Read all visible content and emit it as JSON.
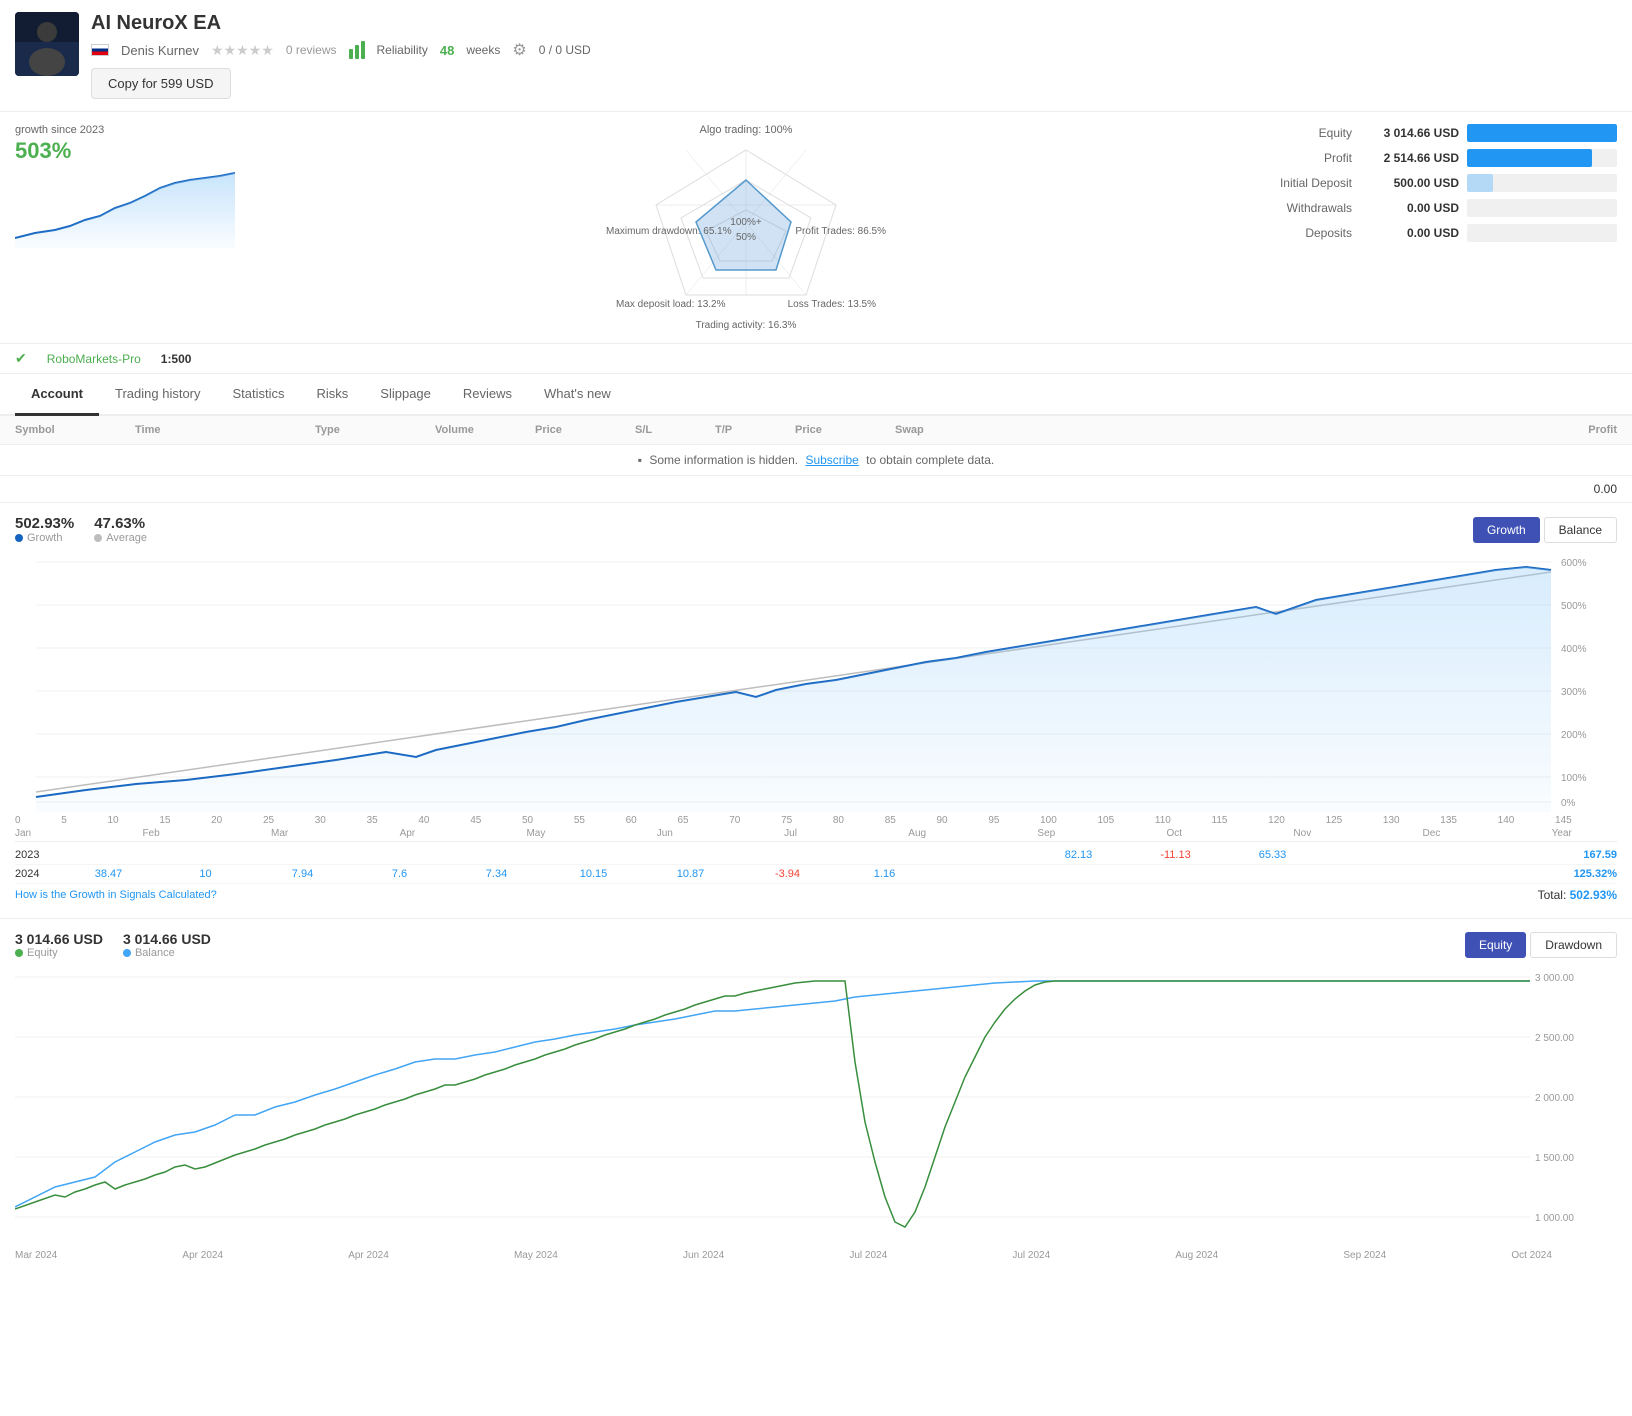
{
  "header": {
    "title": "AI NeuroX EA",
    "author": "Denis Kurnev",
    "reviews": "0 reviews",
    "reliability_label": "Reliability",
    "weeks": "48",
    "weeks_label": "weeks",
    "balance": "0 / 0 USD",
    "copy_btn": "Copy for 599 USD"
  },
  "stats": {
    "growth_since": "growth since 2023",
    "growth_value": "503%",
    "algo_trading": "Algo trading: 100%",
    "max_drawdown": "Maximum drawdown: 65.1%",
    "profit_trades": "Profit Trades: 86.5%",
    "loss_trades": "Loss Trades: 13.5%",
    "max_deposit_load": "Max deposit load: 13.2%",
    "trading_activity": "Trading activity: 16.3%"
  },
  "equity": {
    "rows": [
      {
        "label": "Equity",
        "value": "3 014.66 USD",
        "pct": 100,
        "color": "blue"
      },
      {
        "label": "Profit",
        "value": "2 514.66 USD",
        "pct": 83,
        "color": "blue"
      },
      {
        "label": "Initial Deposit",
        "value": "500.00 USD",
        "pct": 17,
        "color": "light-blue"
      },
      {
        "label": "Withdrawals",
        "value": "0.00 USD",
        "pct": 0,
        "color": "blue"
      },
      {
        "label": "Deposits",
        "value": "0.00 USD",
        "pct": 0,
        "color": "blue"
      }
    ]
  },
  "broker": {
    "name": "RoboMarkets-Pro",
    "leverage": "1:500"
  },
  "tabs": [
    {
      "label": "Account",
      "active": true
    },
    {
      "label": "Trading history",
      "active": false
    },
    {
      "label": "Statistics",
      "active": false
    },
    {
      "label": "Risks",
      "active": false
    },
    {
      "label": "Slippage",
      "active": false
    },
    {
      "label": "Reviews",
      "active": false
    },
    {
      "label": "What's new",
      "active": false
    }
  ],
  "table": {
    "columns": [
      "Symbol",
      "Time",
      "Type",
      "Volume",
      "Price",
      "S/L",
      "T/P",
      "Price",
      "Swap",
      "Profit"
    ],
    "hidden_msg": "Some information is hidden.",
    "subscribe_text": "Subscribe",
    "hidden_msg2": "to obtain complete data.",
    "profit_value": "0.00"
  },
  "growth_chart": {
    "stat1_value": "502.93%",
    "stat1_label": "Growth",
    "stat2_value": "47.63%",
    "stat2_label": "Average",
    "btn_growth": "Growth",
    "btn_balance": "Balance",
    "y_labels": [
      "600%",
      "500%",
      "400%",
      "300%",
      "200%",
      "100%",
      "0%"
    ],
    "x_labels": [
      "0",
      "5",
      "10",
      "15",
      "20",
      "25",
      "30",
      "35",
      "40",
      "45",
      "50",
      "55",
      "60",
      "65",
      "70",
      "75",
      "80",
      "85",
      "90",
      "95",
      "100",
      "105",
      "110",
      "115",
      "120",
      "125",
      "130",
      "135",
      "140",
      "145"
    ],
    "month_labels": [
      "Jan",
      "Feb",
      "Mar",
      "Apr",
      "May",
      "Jun",
      "Jul",
      "Aug",
      "Sep",
      "Oct",
      "Nov",
      "Dec",
      "Year"
    ],
    "year_rows": [
      {
        "year": "2023",
        "values": [
          "",
          "",
          "",
          "",
          "",
          "",
          "",
          "",
          "",
          "",
          "",
          "82.13",
          "-11.13",
          "65.33",
          "167.59"
        ]
      },
      {
        "year": "2024",
        "values": [
          "38.47",
          "10",
          "7.94",
          "7.6",
          "7.34",
          "10.15",
          "10.87",
          "-3.94",
          "1.16",
          "",
          "",
          "",
          "",
          "",
          "125.32%"
        ]
      }
    ],
    "how_link": "How is the Growth in Signals Calculated?",
    "total_label": "Total:",
    "total_value": "502.93%"
  },
  "equity_chart": {
    "stat1_value": "3 014.66 USD",
    "stat1_label": "Equity",
    "stat2_value": "3 014.66 USD",
    "stat2_label": "Balance",
    "btn_equity": "Equity",
    "btn_drawdown": "Drawdown",
    "month_labels": [
      "Mar 2024",
      "Apr 2024",
      "Apr 2024",
      "May 2024",
      "Jun 2024",
      "Jul 2024",
      "Jul 2024",
      "Aug 2024",
      "Sep 2024",
      "Oct 2024"
    ],
    "y_labels": [
      "3 000.00",
      "2 500.00",
      "2 000.00",
      "1 500.00",
      "1 000.00"
    ]
  },
  "colors": {
    "green": "#4caf50",
    "blue": "#2196f3",
    "blue_dark": "#3f51b5",
    "red": "#f44336",
    "gray": "#9e9e9e",
    "light_blue_line": "#90caf9",
    "growth_line": "#1565c0",
    "avg_line": "#bdbdbd",
    "equity_green": "#388e3c",
    "equity_blue": "#42a5f5"
  }
}
